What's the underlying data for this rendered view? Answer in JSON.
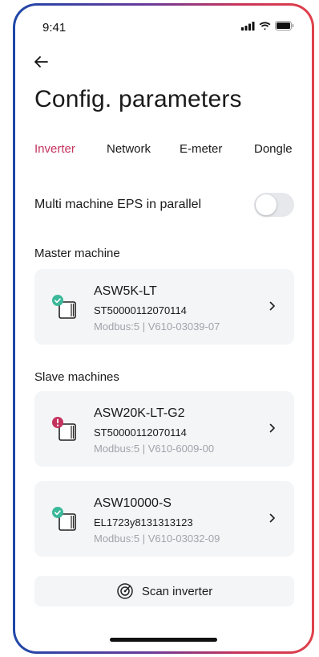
{
  "status_bar": {
    "time": "9:41"
  },
  "page": {
    "title": "Config. parameters"
  },
  "tabs": [
    {
      "label": "Inverter",
      "active": true
    },
    {
      "label": "Network",
      "active": false
    },
    {
      "label": "E-meter",
      "active": false
    },
    {
      "label": "Dongle",
      "active": false
    }
  ],
  "eps": {
    "label": "Multi machine EPS in parallel",
    "enabled": false
  },
  "master": {
    "section_title": "Master  machine",
    "device": {
      "name": "ASW5K-LT",
      "sn": "ST50000112070114",
      "meta": "Modbus:5 | V610-03039-07",
      "status": "ok"
    }
  },
  "slaves": {
    "section_title": "Slave machines",
    "devices": [
      {
        "name": "ASW20K-LT-G2",
        "sn": "ST50000112070114",
        "meta": "Modbus:5 | V610-6009-00",
        "status": "error"
      },
      {
        "name": "ASW10000-S",
        "sn": "EL1723y8131313123",
        "meta": "Modbus:5 | V610-03032-09",
        "status": "ok"
      }
    ]
  },
  "scan_button": {
    "label": "Scan inverter",
    "icon": "radar-icon"
  },
  "colors": {
    "accent": "#c4325e",
    "ok": "#3cb89a",
    "error": "#c4325e",
    "card": "#f3f5f7"
  }
}
